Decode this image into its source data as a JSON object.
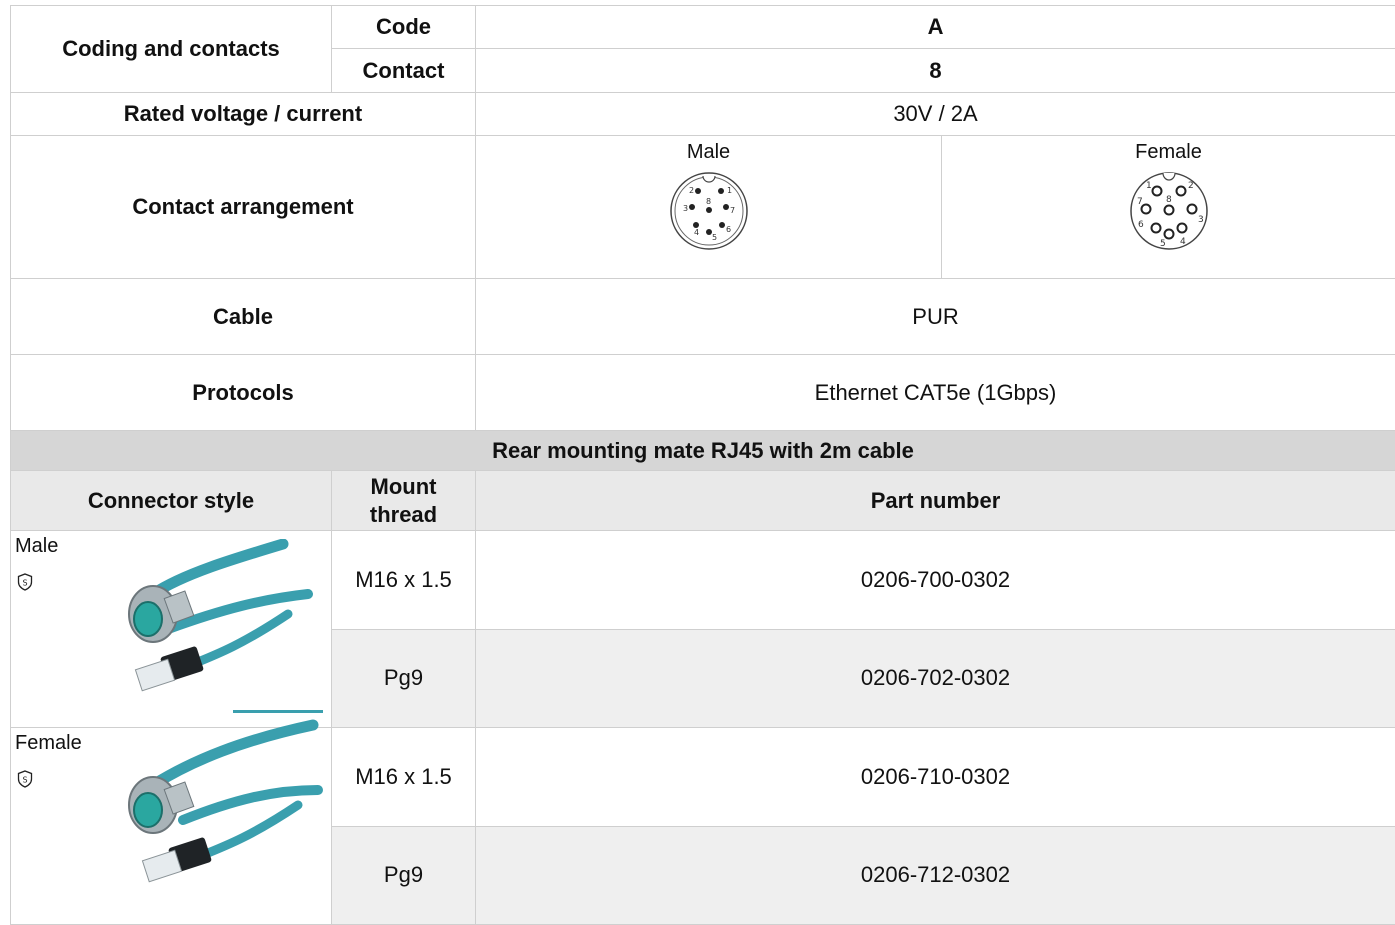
{
  "specs": {
    "coding_label": "Coding and contacts",
    "code_label": "Code",
    "code_value": "A",
    "contact_label": "Contact",
    "contact_value": "8",
    "rated_label": "Rated voltage / current",
    "rated_value": "30V / 2A",
    "arrangement_label": "Contact arrangement",
    "male_label": "Male",
    "female_label": "Female",
    "male_pins": [
      "1",
      "2",
      "3",
      "4",
      "5",
      "6",
      "7",
      "8"
    ],
    "female_pins": [
      "1",
      "2",
      "3",
      "4",
      "5",
      "6",
      "7",
      "8"
    ],
    "cable_label": "Cable",
    "cable_value": "PUR",
    "protocols_label": "Protocols",
    "protocols_value": "Ethernet CAT5e (1Gbps)"
  },
  "mating": {
    "title": "Rear mounting mate RJ45 with 2m cable",
    "headers": {
      "style": "Connector style",
      "thread_line1": "Mount",
      "thread_line2": "thread",
      "part": "Part number"
    },
    "groups": [
      {
        "style": "Male",
        "badge": "S",
        "rows": [
          {
            "thread": "M16 x 1.5",
            "part": "0206-700-0302"
          },
          {
            "thread": "Pg9",
            "part": "0206-702-0302"
          }
        ]
      },
      {
        "style": "Female",
        "badge": "S",
        "rows": [
          {
            "thread": "M16 x 1.5",
            "part": "0206-710-0302"
          },
          {
            "thread": "Pg9",
            "part": "0206-712-0302"
          }
        ]
      }
    ]
  },
  "colors": {
    "cable": "#3a9fae",
    "border": "#cfcfcf",
    "band": "#d6d6d6",
    "header": "#e9e9e9",
    "alt_row": "#efefef"
  },
  "icons": [
    "shield-s-icon",
    "male-pin-diagram",
    "female-pin-diagram",
    "cable-assembly-image"
  ]
}
